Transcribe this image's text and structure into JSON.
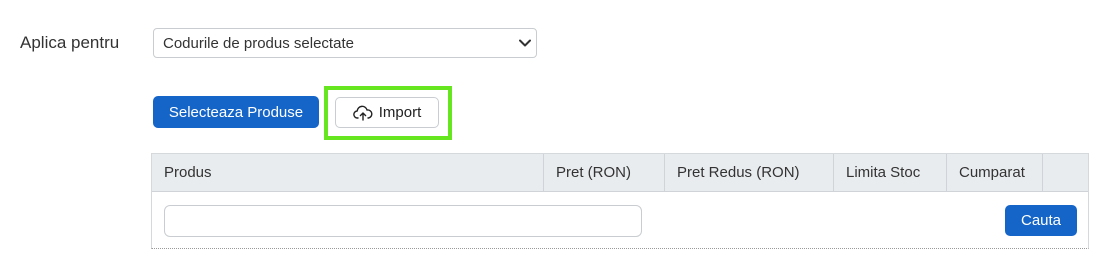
{
  "form": {
    "apply_label": "Aplica pentru",
    "apply_select_value": "Codurile de produs selectate"
  },
  "actions": {
    "select_products_label": "Selecteaza Produse",
    "import_label": "Import",
    "import_icon": "cloud-upload-icon"
  },
  "table": {
    "columns": [
      "Produs",
      "Pret (RON)",
      "Pret Redus (RON)",
      "Limita Stoc",
      "Cumparat",
      ""
    ],
    "search_input_value": "",
    "search_button_label": "Cauta"
  },
  "colors": {
    "primary": "#1565c8",
    "highlight": "#66e61e",
    "header_bg": "#e9ecef"
  }
}
